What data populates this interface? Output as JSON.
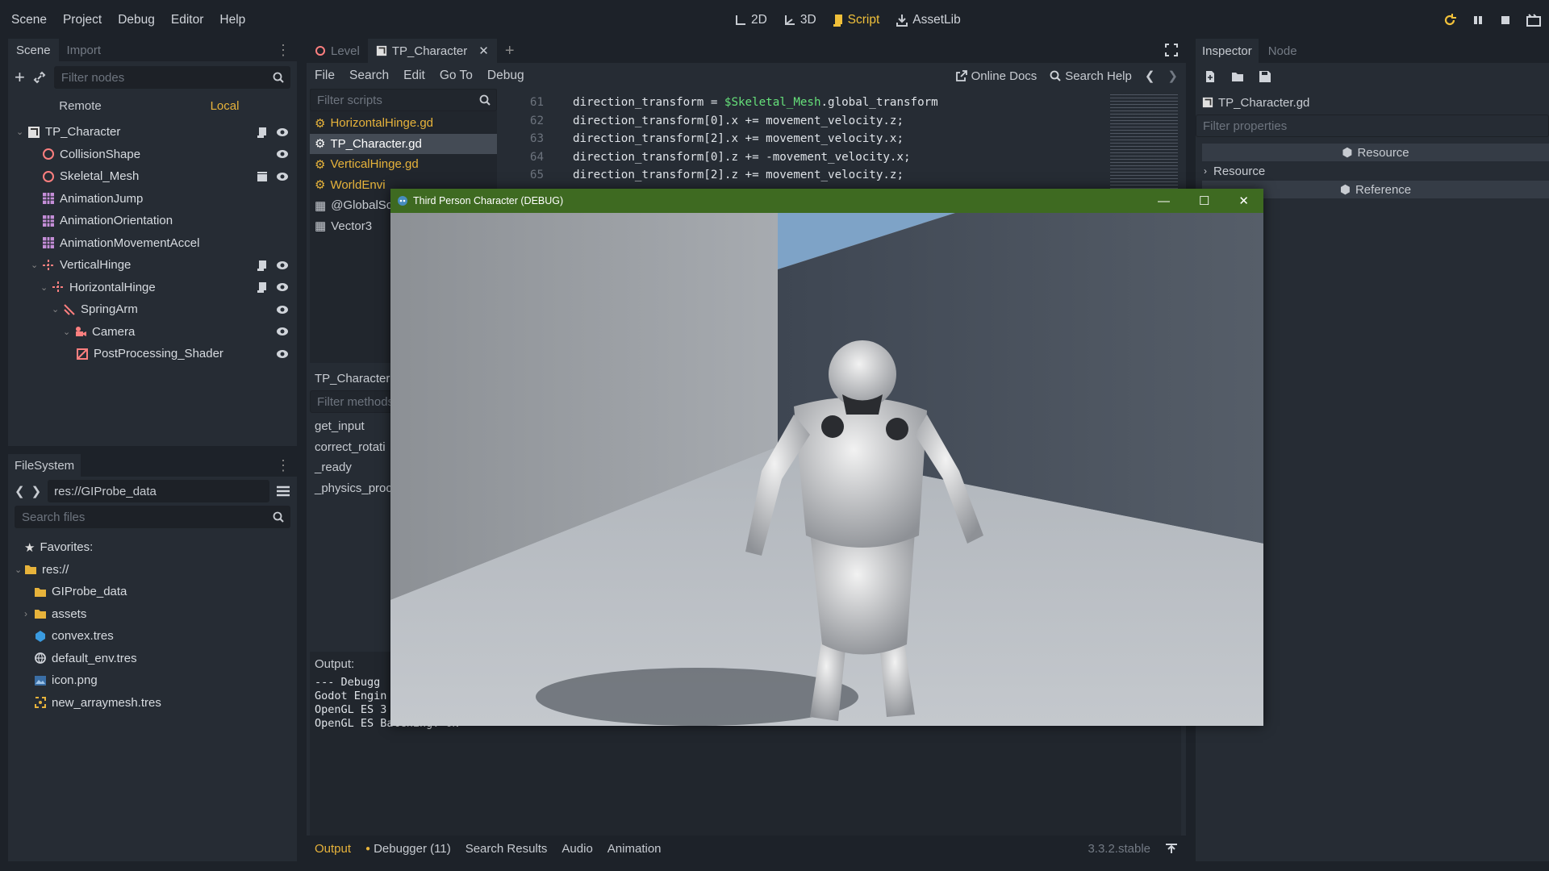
{
  "menubar": {
    "items": [
      "Scene",
      "Project",
      "Debug",
      "Editor",
      "Help"
    ],
    "workspaces": {
      "w2d": "2D",
      "w3d": "3D",
      "script": "Script",
      "assetlib": "AssetLib"
    }
  },
  "scene_dock": {
    "tabs": {
      "scene": "Scene",
      "import": "Import"
    },
    "filter_placeholder": "Filter nodes",
    "remote": "Remote",
    "local": "Local",
    "nodes": [
      "TP_Character",
      "CollisionShape",
      "Skeletal_Mesh",
      "AnimationJump",
      "AnimationOrientation",
      "AnimationMovementAccel",
      "VerticalHinge",
      "HorizontalHinge",
      "SpringArm",
      "Camera",
      "PostProcessing_Shader"
    ]
  },
  "filesystem": {
    "title": "FileSystem",
    "path": "res://GIProbe_data",
    "search_placeholder": "Search files",
    "favorites": "Favorites:",
    "root": "res://",
    "items": [
      "GIProbe_data",
      "assets",
      "convex.tres",
      "default_env.tres",
      "icon.png",
      "new_arraymesh.tres"
    ]
  },
  "editor": {
    "tabs": {
      "level": "Level",
      "tp": "TP_Character"
    },
    "menu": {
      "file": "File",
      "search": "Search",
      "edit": "Edit",
      "goto": "Go To",
      "debug": "Debug"
    },
    "online_docs": "Online Docs",
    "search_help": "Search Help",
    "filter_scripts": "Filter scripts",
    "scripts": [
      "HorizontalHinge.gd",
      "TP_Character.gd",
      "VerticalHinge.gd",
      "WorldEnvi",
      "@GlobalSc",
      "Vector3"
    ],
    "methods_title": "TP_Character",
    "filter_methods": "Filter methods",
    "methods": [
      "get_input",
      "correct_rotati",
      "_ready",
      "_physics_proc"
    ],
    "code_lines": [
      {
        "n": "61",
        "pre": "direction_transform = ",
        "var": "$Skeletal_Mesh",
        "post": ".global_transform"
      },
      {
        "n": "62",
        "pre": "direction_transform[0].x += movement_velocity.z;",
        "var": "",
        "post": ""
      },
      {
        "n": "63",
        "pre": "direction_transform[2].x += movement_velocity.x;",
        "var": "",
        "post": ""
      },
      {
        "n": "64",
        "pre": "direction_transform[0].z += -movement_velocity.x;",
        "var": "",
        "post": ""
      },
      {
        "n": "65",
        "pre": "direction_transform[2].z += movement_velocity.z;",
        "var": "",
        "post": ""
      }
    ]
  },
  "output": {
    "title": "Output:",
    "lines": [
      "--- Debugg",
      "Godot Engin",
      "OpenGL ES 3",
      "OpenGL ES Batching: ON"
    ],
    "bottom_tabs": {
      "output": "Output",
      "debugger": "Debugger (11)",
      "search": "Search Results",
      "audio": "Audio",
      "animation": "Animation"
    },
    "version": "3.3.2.stable"
  },
  "inspector": {
    "tabs": {
      "inspector": "Inspector",
      "node": "Node"
    },
    "file": "TP_Character.gd",
    "filter_placeholder": "Filter properties",
    "resource_header": "Resource",
    "resource_section": "Resource",
    "reference_header": "Reference"
  },
  "game_window": {
    "title": "Third Person Character (DEBUG)"
  }
}
